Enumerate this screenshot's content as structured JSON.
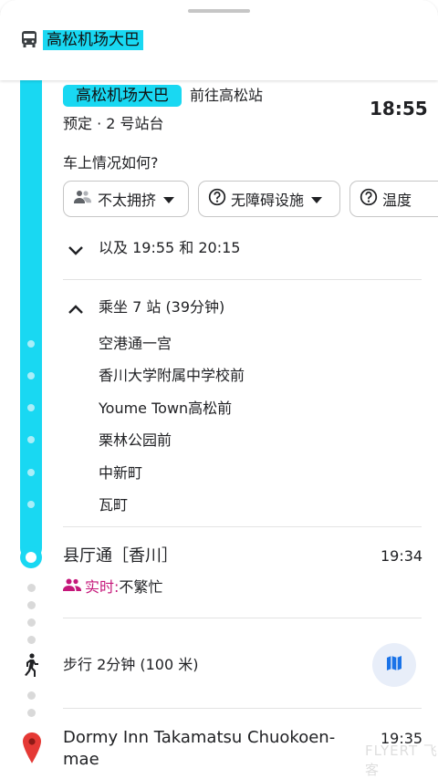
{
  "header": {
    "title": "高松机场大巴",
    "icon": "bus-icon"
  },
  "trip": {
    "route_chip": "高松机场大巴",
    "direction": "前往高松站",
    "departure_time": "18:55",
    "schedule_platform": "预定 · 2 号站台",
    "feedback_question": "车上情况如何?",
    "feedback_chips": [
      {
        "label": "不太拥挤",
        "icon": "crowd-icon"
      },
      {
        "label": "无障碍设施",
        "icon": "help-circle-icon"
      },
      {
        "label": "温度",
        "icon": "help-circle-icon"
      }
    ],
    "more_times": "以及 19:55 和 20:15",
    "ride_summary": "乘坐 7 站 (39分钟)",
    "intermediate_stops": [
      "空港通一宫",
      "香川大学附属中学校前",
      "Youme Town高松前",
      "栗林公园前",
      "中新町",
      "瓦町"
    ],
    "arrival_stop": "县厅通［香川］",
    "arrival_time": "19:34",
    "realtime_label": "实时:",
    "realtime_value": "不繁忙"
  },
  "walk": {
    "text": "步行 2分钟 (100 米)",
    "icon": "walk-icon",
    "map_button_icon": "map-icon"
  },
  "destination": {
    "name": "Dormy Inn Takamatsu Chuokoen-mae",
    "time": "19:35",
    "icon": "pin-icon"
  },
  "watermark": "FLYERT 飞客",
  "colors": {
    "route": "#19d8f2",
    "realtime": "#c5177a",
    "map_button_bg": "#e8eef9",
    "map_icon": "#1a73e8",
    "pin": "#e53935"
  }
}
